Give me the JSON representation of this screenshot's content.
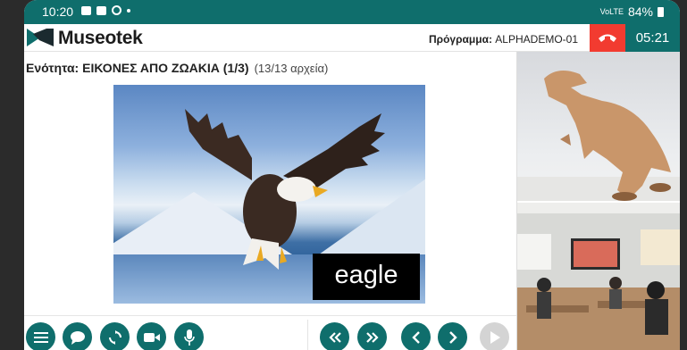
{
  "status_bar": {
    "time": "10:20",
    "network": "VoLTE",
    "battery": "84%"
  },
  "header": {
    "brand": "Museotek",
    "program_label": "Πρόγραμμα:",
    "program_value": "ALPHADEMO-01",
    "timer": "05:21"
  },
  "section": {
    "title": "Ενότητα: ΕΙΚΟΝΕΣ ΑΠΟ ΖΩΑΚΙΑ (1/3)",
    "count": "(13/13 αρχεία)"
  },
  "slide": {
    "label": "eagle"
  },
  "toolbar": {
    "left_buttons": [
      "menu-icon",
      "chat-icon",
      "sync-icon",
      "video-camera-icon",
      "microphone-icon"
    ],
    "nav_buttons": [
      "double-left-icon",
      "double-right-icon",
      "chevron-left-icon",
      "chevron-right-icon",
      "play-icon"
    ]
  },
  "colors": {
    "brand_teal": "#0f6e6c",
    "hangup_red": "#f23b30",
    "disabled_gray": "#d4d4d4"
  }
}
